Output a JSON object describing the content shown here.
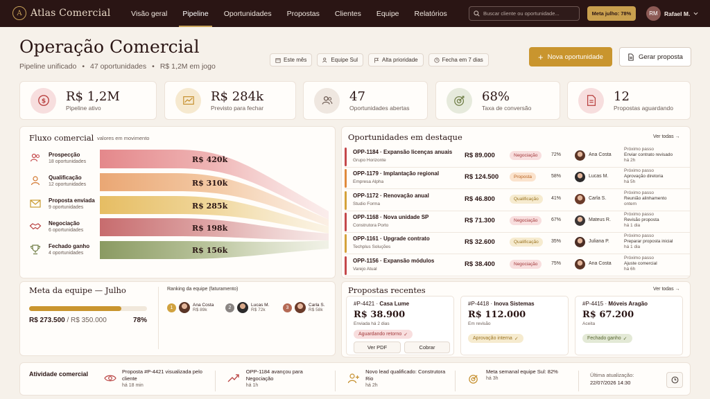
{
  "brand": {
    "name": "Atlas Comercial",
    "logo_letter": "A"
  },
  "nav": [
    {
      "label": "Visão geral"
    },
    {
      "label": "Pipeline"
    },
    {
      "label": "Oportunidades"
    },
    {
      "label": "Propostas"
    },
    {
      "label": "Clientes"
    },
    {
      "label": "Equipe"
    },
    {
      "label": "Relatórios"
    }
  ],
  "active_nav": "Pipeline",
  "search": {
    "placeholder": "Buscar cliente ou oportunidade..."
  },
  "meta_badge": "Meta julho: 78%",
  "user": {
    "initials": "RM",
    "name": "Rafael M."
  },
  "header": {
    "title": "Operação Comercial",
    "sub1": "Pipeline unificado",
    "sub2": "47 oportunidades",
    "sub3": "R$ 1,2M em jogo",
    "dot": "•"
  },
  "filters": [
    "Este mês",
    "Equipe Sul",
    "Alta prioridade",
    "Fecha em 7 dias"
  ],
  "actions": {
    "new": "Nova oportunidade",
    "new_plus": "+",
    "proposal": "Gerar proposta"
  },
  "kpis": [
    {
      "value": "R$ 1,2M",
      "label": "Pipeline ativo",
      "icon": "dollar-icon"
    },
    {
      "value": "R$ 284k",
      "label": "Previsto para fechar",
      "icon": "trend-icon"
    },
    {
      "value": "47",
      "label": "Oportunidades abertas",
      "icon": "users-icon"
    },
    {
      "value": "68%",
      "label": "Taxa de conversão",
      "icon": "target-icon"
    },
    {
      "value": "12",
      "label": "Propostas aguardando",
      "icon": "document-icon"
    }
  ],
  "funnel": {
    "title": "Fluxo comercial",
    "subtitle": "valores em movimento",
    "stages": [
      {
        "label": "Prospecção",
        "count": "18 oportunidades",
        "value": "R$ 420k",
        "color": "#e4888b"
      },
      {
        "label": "Qualificação",
        "count": "12 oportunidades",
        "value": "R$ 310k",
        "color": "#eaa774"
      },
      {
        "label": "Proposta enviada",
        "count": "9 oportunidades",
        "value": "R$ 285k",
        "color": "#e6bd63"
      },
      {
        "label": "Negociação",
        "count": "6 oportunidades",
        "value": "R$ 198k",
        "color": "#c76c6e"
      },
      {
        "label": "Fechado ganho",
        "count": "4 oportunidades",
        "value": "R$ 156k",
        "color": "#8a9a62"
      }
    ]
  },
  "highlights": {
    "title": "Oportunidades em destaque",
    "link": "Ver todas",
    "items": [
      {
        "id": "OPP-1184",
        "name": "Expansão licenças anuais",
        "company": "Grupo Horizonte",
        "value": "R$ 89.000",
        "status": "Negociação",
        "prob": "72%",
        "owner": "Ana Costa",
        "next_label": "Próximo passo",
        "next": "Enviar contrato revisado",
        "when": "há 2h",
        "bar": "#c4484b"
      },
      {
        "id": "OPP-1179",
        "name": "Implantação regional",
        "company": "Empresa Alpha",
        "value": "R$ 124.500",
        "status": "Proposta",
        "prob": "58%",
        "owner": "Lucas M.",
        "next_label": "Próximo passo",
        "next": "Aprovação diretoria",
        "when": "há 5h",
        "bar": "#e08a3c"
      },
      {
        "id": "OPP-1172",
        "name": "Renovação anual",
        "company": "Studio Forma",
        "value": "R$ 46.800",
        "status": "Qualificação",
        "prob": "41%",
        "owner": "Carla S.",
        "next_label": "Próximo passo",
        "next": "Reunião alinhamento",
        "when": "ontem",
        "bar": "#d5a23b"
      },
      {
        "id": "OPP-1168",
        "name": "Nova unidade SP",
        "company": "Construtora Porto",
        "value": "R$ 71.300",
        "status": "Negociação",
        "prob": "67%",
        "owner": "Mateus R.",
        "next_label": "Próximo passo",
        "next": "Revisão proposta",
        "when": "há 1 dia",
        "bar": "#c4484b"
      },
      {
        "id": "OPP-1161",
        "name": "Upgrade contrato",
        "company": "Techplus Soluções",
        "value": "R$ 32.600",
        "status": "Qualificação",
        "prob": "35%",
        "owner": "Juliana P.",
        "next_label": "Próximo passo",
        "next": "Preparar proposta inicial",
        "when": "há 1 dia",
        "bar": "#d5a23b"
      },
      {
        "id": "OPP-1156",
        "name": "Expansão módulos",
        "company": "Varejo Atual",
        "value": "R$ 38.400",
        "status": "Negociação",
        "prob": "75%",
        "owner": "Ana Costa",
        "next_label": "Próximo passo",
        "next": "Ajuste comercial",
        "when": "há 6h",
        "bar": "#c4484b"
      }
    ]
  },
  "goal": {
    "title": "Meta da equipe — Julho",
    "current": "R$ 273.500",
    "target": "/ R$ 350.000",
    "percent_label": "78%",
    "progress": 0.78,
    "ranking_title": "Ranking da equipe (faturamento)",
    "ranking": [
      {
        "pos": "1",
        "name": "Ana Costa",
        "value": "R$ 89k",
        "color": "#d1a23f"
      },
      {
        "pos": "2",
        "name": "Lucas M.",
        "value": "R$ 72k",
        "color": "#8a8583"
      },
      {
        "pos": "3",
        "name": "Carla S.",
        "value": "R$ 58k",
        "color": "#b56a55"
      }
    ]
  },
  "proposals": {
    "title": "Propostas recentes",
    "link": "Ver todas",
    "items": [
      {
        "id": "#P-4421",
        "name": "Casa Lume",
        "value": "R$ 38.900",
        "date": "Enviada há 2 dias",
        "status": "Aguardando retorno",
        "btn1": "Ver PDF",
        "btn2": "Cobrar"
      },
      {
        "id": "#P-4418",
        "name": "Inova Sistemas",
        "value": "R$ 112.000",
        "date": "Em revisão",
        "status": "Aprovação interna"
      },
      {
        "id": "#P-4415",
        "name": "Móveis Aragão",
        "value": "R$ 67.200",
        "date": "Aceita",
        "status": "Fechado ganho"
      }
    ]
  },
  "activity": {
    "title": "Atividade comercial",
    "items": [
      {
        "text": "Proposta #P-4421 visualizada pelo cliente",
        "time": "há 18 min",
        "icon": "eye-icon"
      },
      {
        "text": "OPP-1184 avançou para Negociação",
        "time": "há 1h",
        "icon": "trend-up-icon"
      },
      {
        "text": "Novo lead qualificado: Construtora Rio",
        "time": "há 2h",
        "icon": "user-plus-icon"
      },
      {
        "text": "Meta semanal equipe Sul: 82%",
        "time": "há 3h",
        "icon": "target-icon"
      }
    ],
    "updated_label": "Última atualização:",
    "updated_value": "22/07/2026 14:30"
  }
}
